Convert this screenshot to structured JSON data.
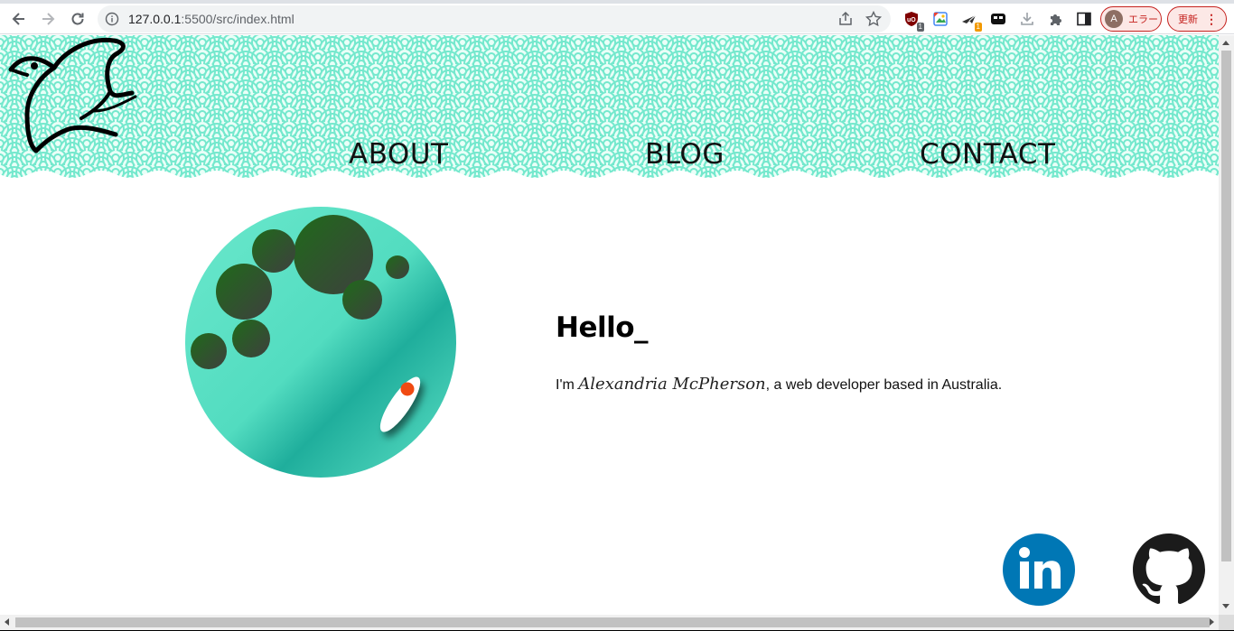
{
  "browser": {
    "url_host": "127.0.0.1",
    "url_path": ":5500/src/index.html",
    "badges": {
      "ublock": "1",
      "ext_orange": "1"
    },
    "profile": {
      "initial": "A",
      "label": "エラー"
    },
    "update_label": "更新"
  },
  "site": {
    "nav": [
      {
        "label": "ABOUT"
      },
      {
        "label": "BLOG"
      },
      {
        "label": "CONTACT"
      }
    ],
    "greeting": "Hello_",
    "intro": {
      "prefix": "I'm ",
      "name": "Alexandria McPherson",
      "suffix": ", a web developer based in Australia."
    },
    "social": [
      {
        "icon": "linkedin-icon",
        "color": "#0077b5"
      },
      {
        "icon": "github-icon",
        "color": "#1b1b1b"
      }
    ],
    "colors": {
      "header_pattern": "#74e8cd",
      "planet_light": "#6be8cc",
      "planet_dark": "#1fae9c",
      "craters": "#1f6a1a",
      "rocket_window": "#f04a12"
    }
  }
}
